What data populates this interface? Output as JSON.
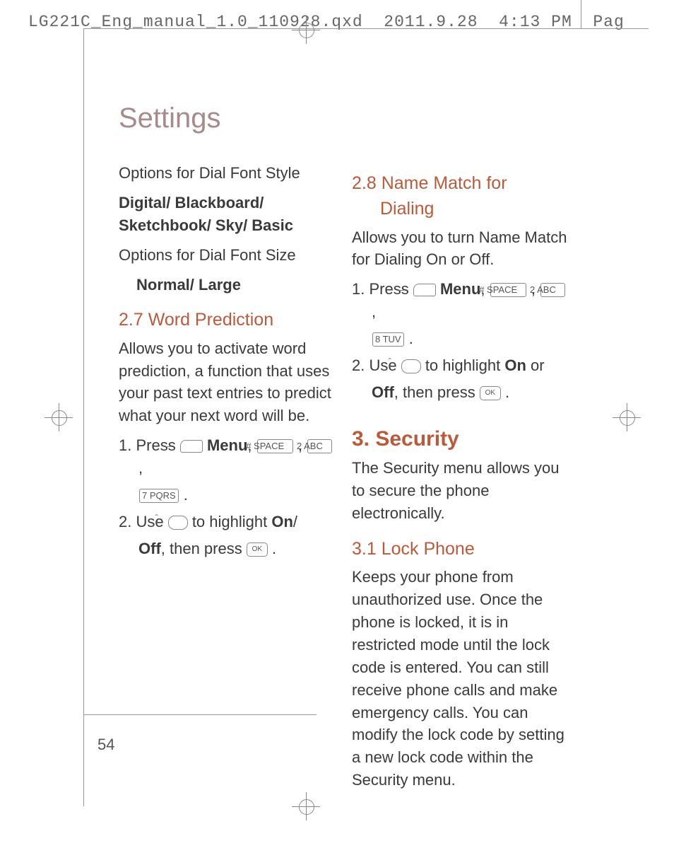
{
  "header": {
    "file": "LG221C_Eng_manual_1.0_110928.qxd",
    "date": "2011.9.28",
    "time": "4:13",
    "ampm": "PM",
    "pagelabel": "Pag"
  },
  "title": "Settings",
  "left": {
    "p1": "Options for Dial Font Style",
    "p1b": "Digital/ Blackboard/ Sketchbook/ Sky/ Basic",
    "p2": "Options for Dial Font Size",
    "p2b": "Normal/ Large",
    "h27": "2.7 Word Prediction",
    "p3": "Allows you to activate word prediction, a function that uses your past text entries to predict what your next word will be.",
    "s1a": "1. Press ",
    "menu": "Menu",
    "key_hash": "# SPACE",
    "key_2": "2 ABC",
    "key_7": "7 PQRS",
    "s2a": "2. Use ",
    "s2b": " to highlight ",
    "on": "On",
    "slash": "/ ",
    "off": "Off",
    "thenpress": ", then press ",
    "ok": "OK"
  },
  "right": {
    "h28a": "2.8 Name Match for",
    "h28b": "Dialing",
    "p1": "Allows you to turn Name Match for Dialing On or Off.",
    "s1a": "1. Press ",
    "menu": "Menu",
    "key_hash": "# SPACE",
    "key_2": "2 ABC",
    "key_8": "8 TUV",
    "s2a": "2. Use ",
    "s2b": " to highlight ",
    "on": "On",
    "or": " or ",
    "off": "Off",
    "thenpress": ", then press ",
    "ok": "OK",
    "h3": "3. Security",
    "p2": "The Security menu allows you to secure the phone electronically.",
    "h31": "3.1 Lock Phone",
    "p3": "Keeps your phone from unauthorized use. Once the phone is locked, it is in restricted mode until the lock code is entered. You can still receive phone calls and make emergency calls. You can modify the lock code by setting a new lock code within the Security menu."
  },
  "pagenum": "54"
}
